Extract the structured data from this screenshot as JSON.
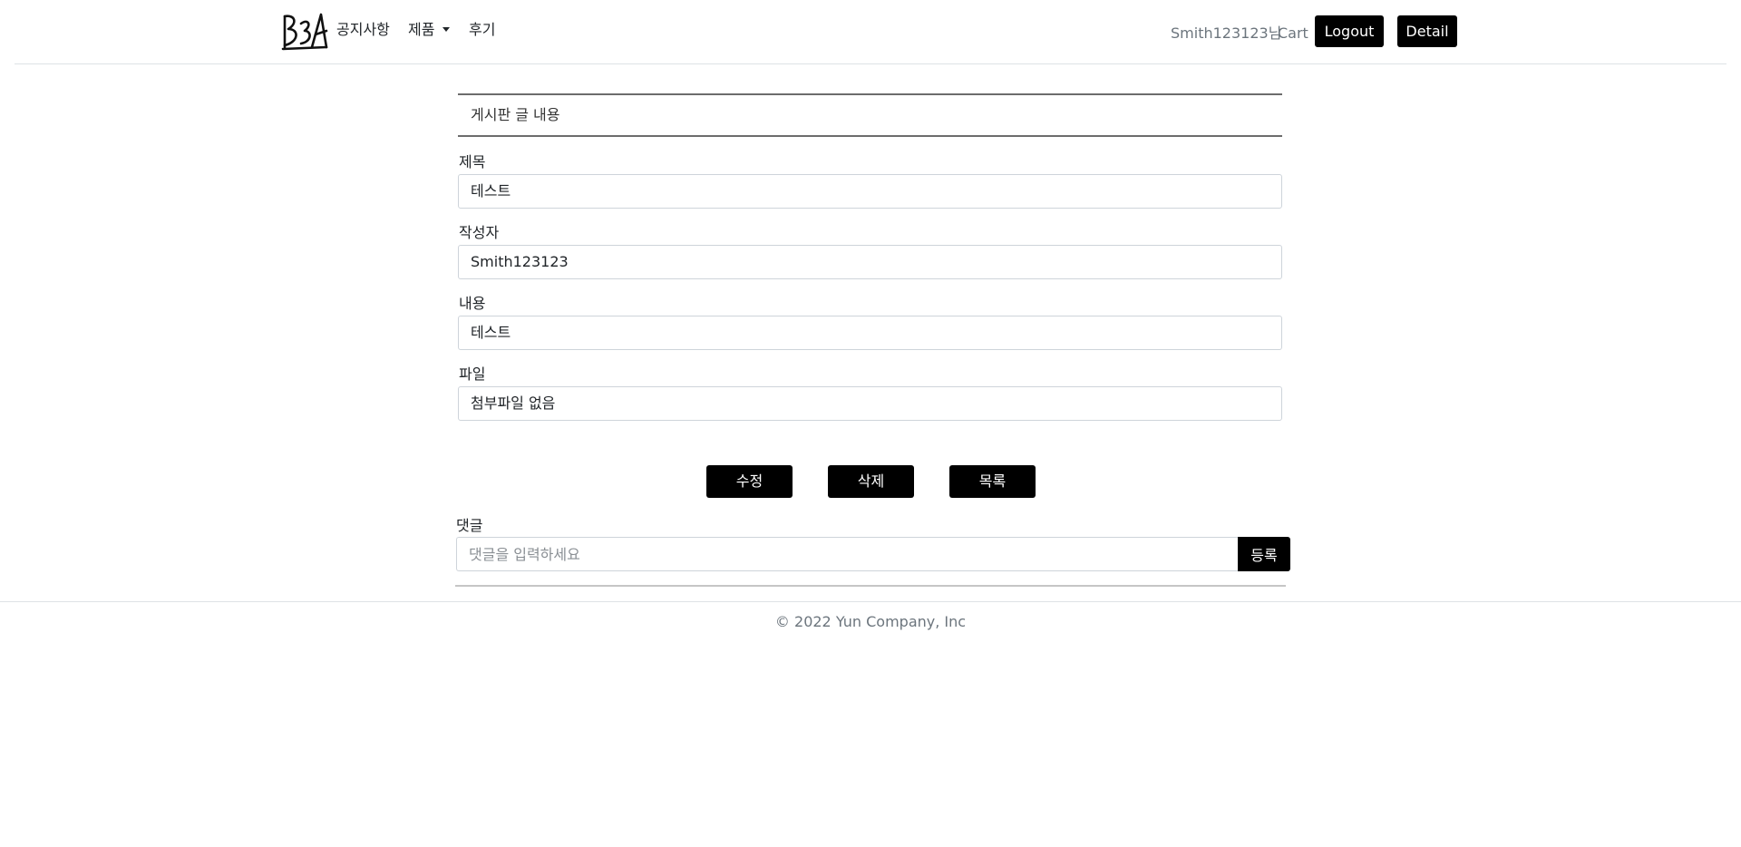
{
  "header": {
    "logo_icon": "brand-logo-icon",
    "nav": {
      "notice": "공지사항",
      "products": "제품",
      "reviews": "후기"
    },
    "user_greeting": "Smith123123님",
    "cart": "Cart",
    "logout": "Logout",
    "detail": "Detail"
  },
  "board": {
    "heading": "게시판 글 내용",
    "fields": {
      "title": {
        "label": "제목",
        "value": "테스트"
      },
      "author": {
        "label": "작성자",
        "value": "Smith123123"
      },
      "content": {
        "label": "내용",
        "value": "테스트"
      },
      "file": {
        "label": "파일",
        "value": "첨부파일 없음"
      }
    },
    "buttons": {
      "edit": "수정",
      "delete": "삭제",
      "list": "목록"
    }
  },
  "comments": {
    "label": "댓글",
    "placeholder": "댓글을 입력하세요",
    "submit": "등록"
  },
  "footer": {
    "copyright": "© 2022 Yun Company, Inc"
  }
}
